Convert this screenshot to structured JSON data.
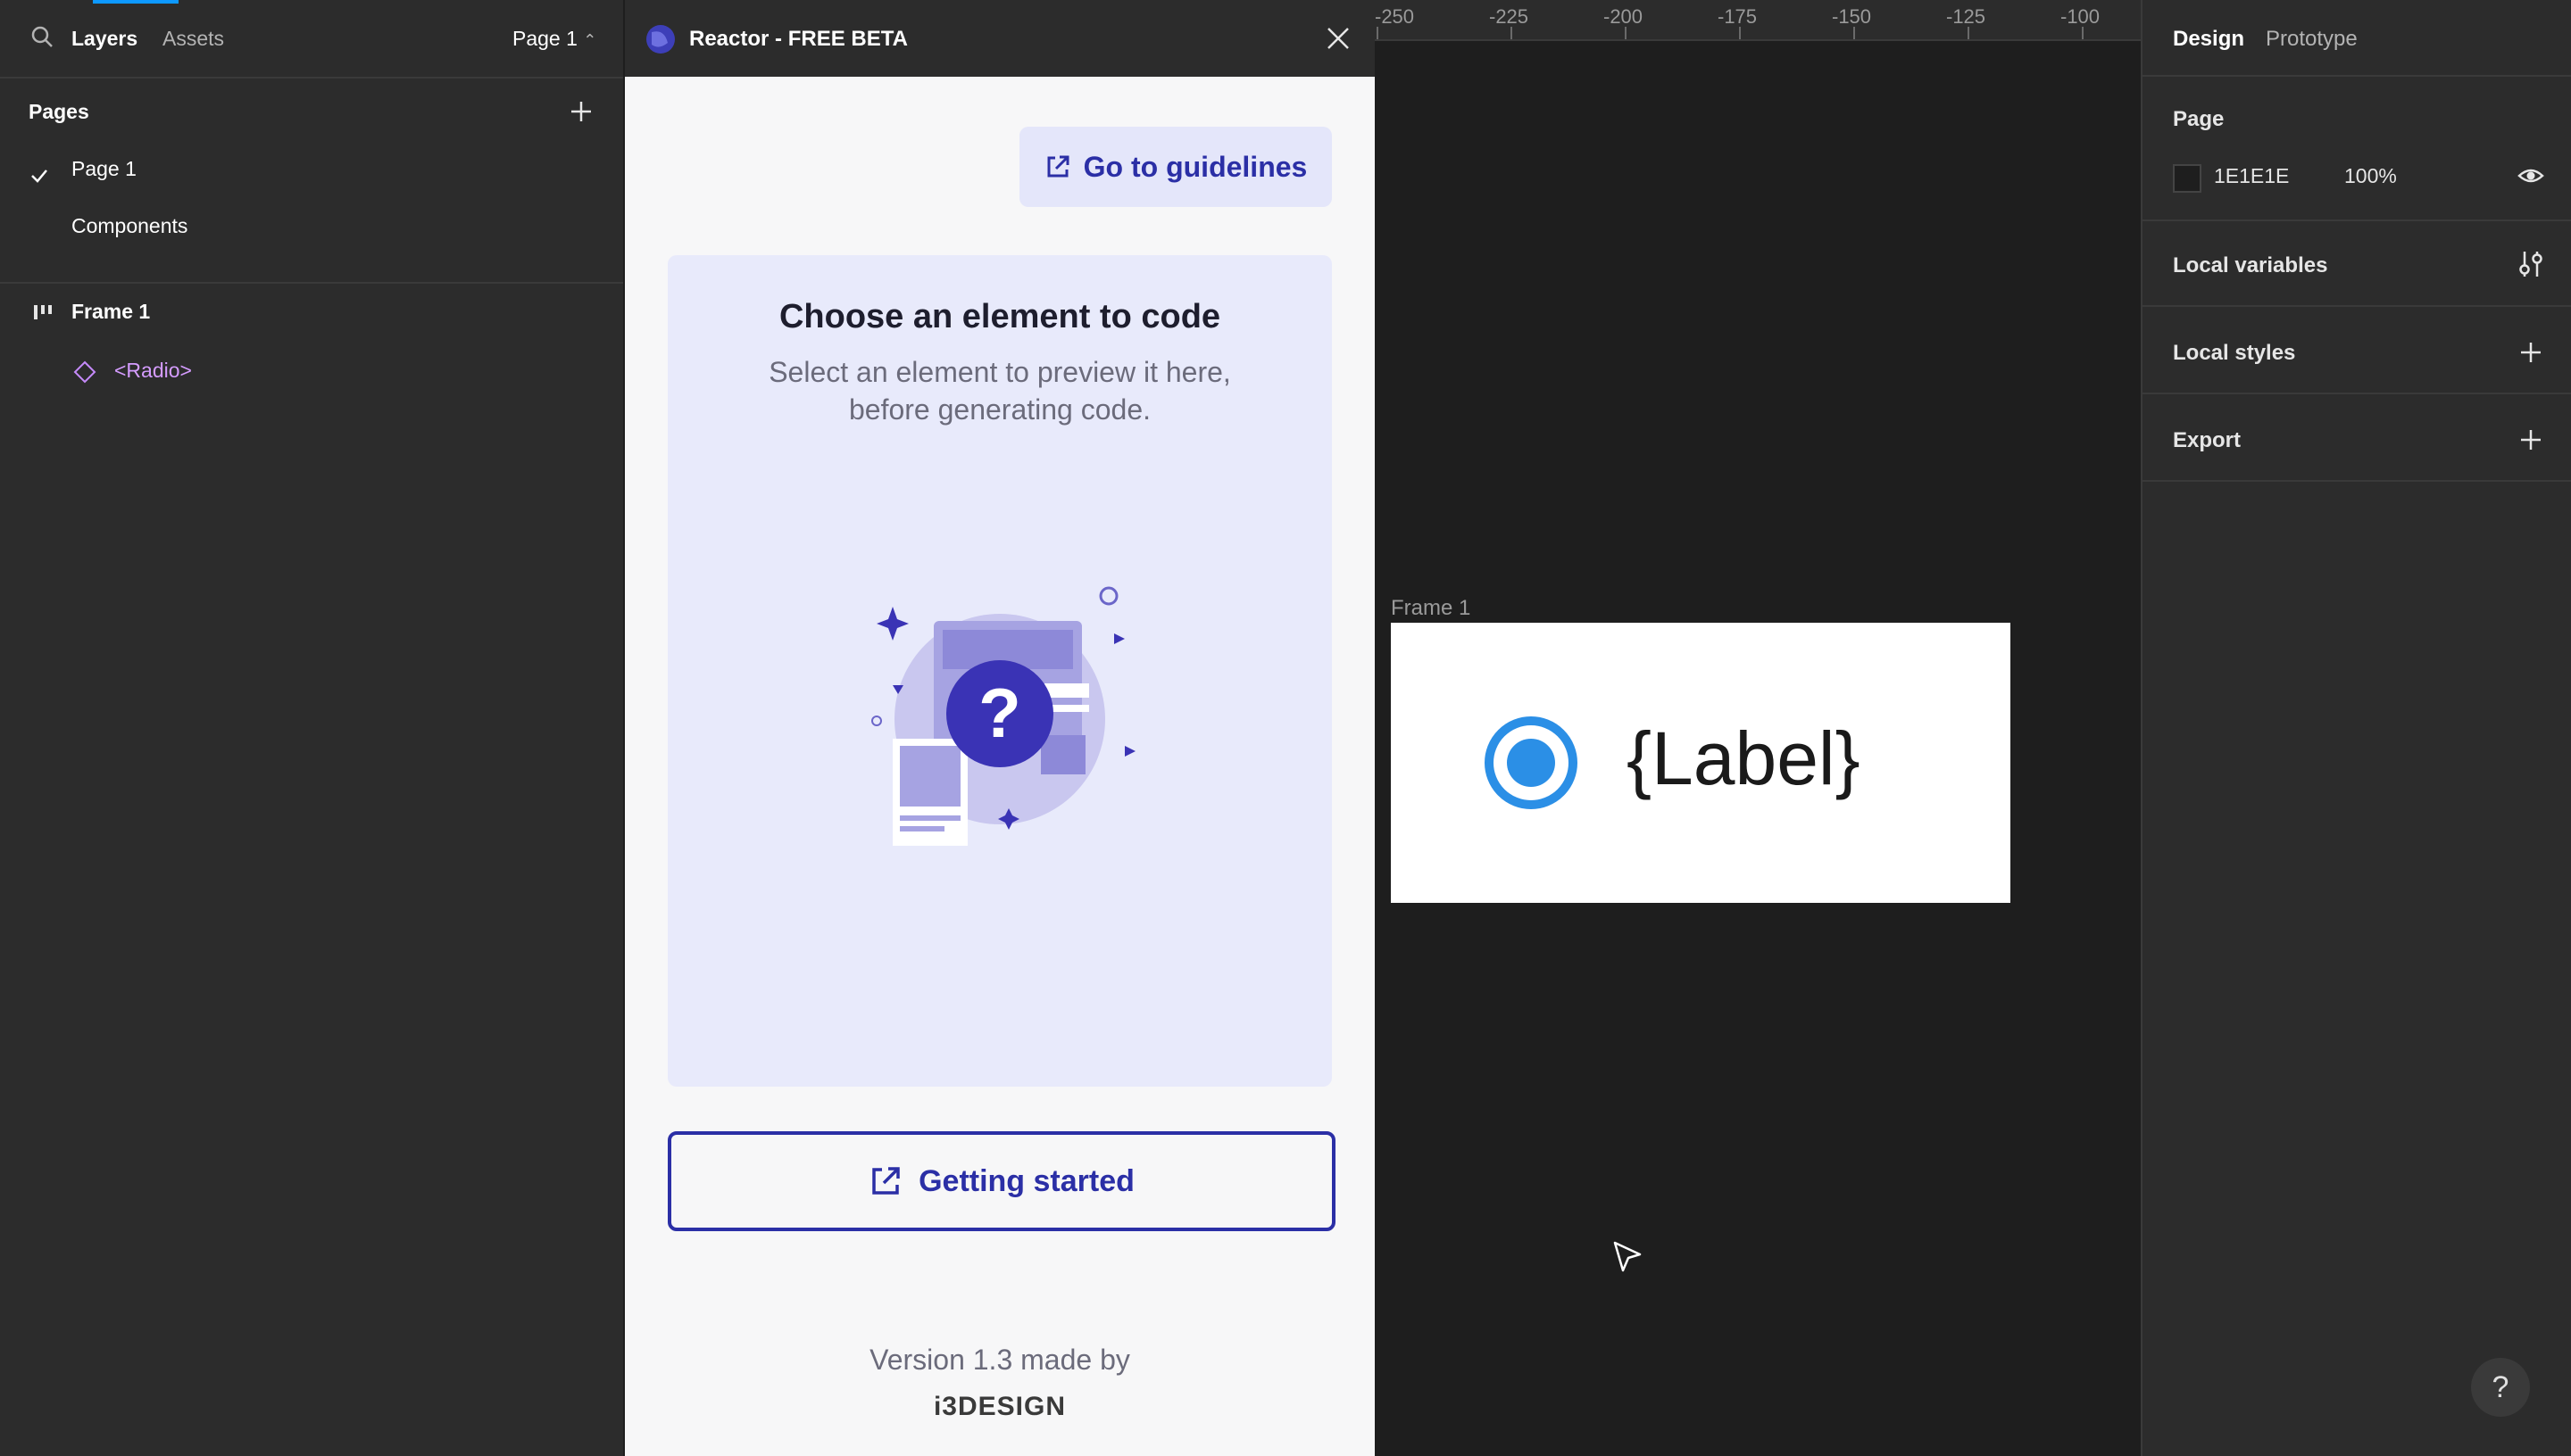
{
  "left_panel": {
    "tabs": {
      "layers": "Layers",
      "assets": "Assets"
    },
    "page_selector": "Page 1",
    "pages_title": "Pages",
    "pages": [
      {
        "label": "Page 1",
        "selected": true
      },
      {
        "label": "Components",
        "selected": false
      }
    ],
    "layers": {
      "frame": "Frame 1",
      "component": "<Radio>"
    }
  },
  "plugin": {
    "title": "Reactor - FREE BETA",
    "guidelines_label": "Go to guidelines",
    "card_title": "Choose an element to code",
    "card_subtitle_line1": "Select an element to preview it here,",
    "card_subtitle_line2": "before generating code.",
    "getting_started_label": "Getting started",
    "version_text": "Version 1.3 made by",
    "brand": "i3DESIGN",
    "colors": {
      "accent": "#2b2fa6",
      "card_bg": "#e8eafb"
    }
  },
  "canvas": {
    "ruler_ticks": [
      "-250",
      "-225",
      "-200",
      "-175",
      "-150",
      "-125",
      "-100"
    ],
    "frame_label": "Frame 1",
    "radio_label": "{Label}",
    "colors": {
      "radio": "#2b8fe6",
      "frame_bg": "#ffffff"
    }
  },
  "right_panel": {
    "tabs": {
      "design": "Design",
      "prototype": "Prototype"
    },
    "page_title": "Page",
    "page_color": "1E1E1E",
    "page_opacity": "100%",
    "local_variables": "Local variables",
    "local_styles": "Local styles",
    "export": "Export"
  },
  "help": "?"
}
